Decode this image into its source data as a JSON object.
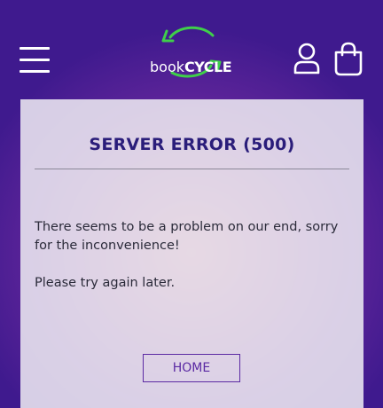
{
  "header": {
    "menu_icon": "hamburger-menu-icon",
    "logo": {
      "part1": "book",
      "part2": "CYCLE",
      "arrow_color": "#3fcf4a"
    },
    "user_icon": "user-icon",
    "cart_icon": "shopping-bag-icon"
  },
  "error_card": {
    "title": "SERVER ERROR (500)",
    "message": "There seems to be a problem on our end, sorry for the inconvenience!",
    "retry_text": "Please try again later.",
    "home_button_label": "HOME"
  },
  "colors": {
    "title": "#2a1d7a",
    "button": "#5b2aa3",
    "logo_arrows": "#3fcf4a",
    "background_gradient": [
      "#c06a82",
      "#5a2398",
      "#3f1a8e"
    ]
  }
}
